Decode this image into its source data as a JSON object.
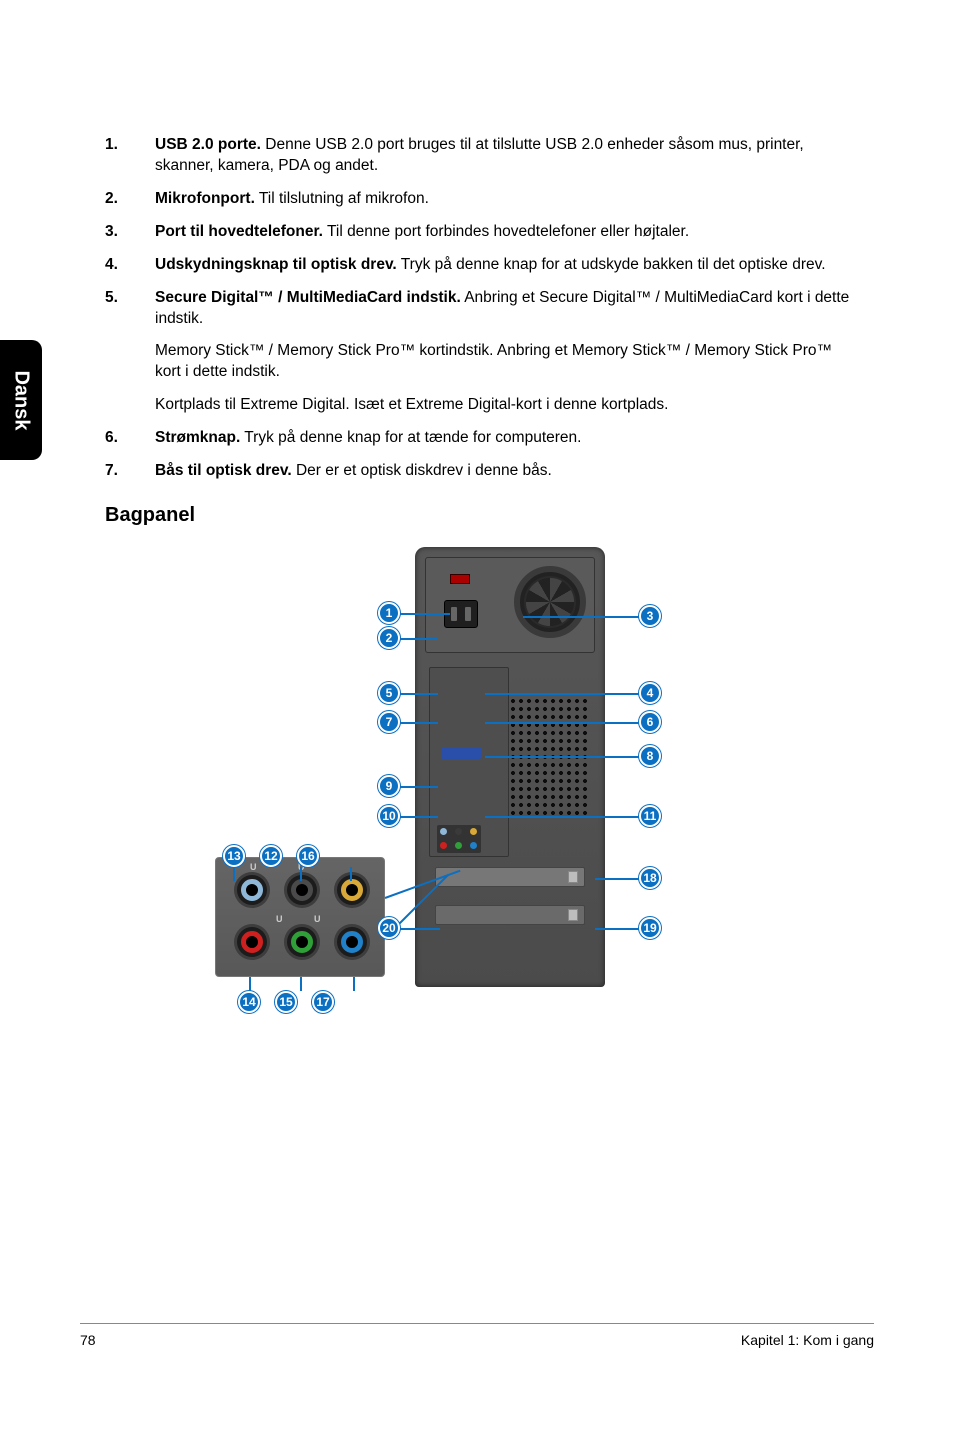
{
  "side_tab": "Dansk",
  "list": [
    {
      "num": "1.",
      "bold": "USB 2.0 porte.",
      "text": " Denne USB 2.0 port bruges til at tilslutte USB 2.0 enheder såsom mus, printer, skanner, kamera, PDA og andet."
    },
    {
      "num": "2.",
      "bold": "Mikrofonport.",
      "text": " Til tilslutning af mikrofon."
    },
    {
      "num": "3.",
      "bold": "Port til hovedtelefoner.",
      "text": " Til denne port forbindes hovedtelefoner eller højtaler."
    },
    {
      "num": "4.",
      "bold": "Udskydningsknap til optisk drev.",
      "text": " Tryk på denne knap for at udskyde bakken til det optiske drev."
    },
    {
      "num": "5.",
      "bold": "Secure Digital™ / MultiMediaCard indstik.",
      "text": " Anbring et Secure Digital™ / MultiMediaCard kort i dette indstik."
    }
  ],
  "sub_paras": [
    {
      "bold": "Memory Stick™ / Memory Stick Pro™ kortindstik.",
      "text": " Anbring et Memory Stick™ / Memory Stick Pro™ kort i dette indstik."
    },
    {
      "bold": "Kortplads til Extreme Digital.",
      "text": " Isæt et Extreme Digital-kort i denne kortplads."
    }
  ],
  "list2": [
    {
      "num": "6.",
      "bold": "Strømknap.",
      "text": " Tryk på denne knap for at tænde for computeren."
    },
    {
      "num": "7.",
      "bold": "Bås til optisk drev.",
      "text": " Der er et optisk diskdrev i denne bås."
    }
  ],
  "section_title": "Bagpanel",
  "callouts": {
    "c1": "1",
    "c2": "2",
    "c3": "3",
    "c4": "4",
    "c5": "5",
    "c6": "6",
    "c7": "7",
    "c8": "8",
    "c9": "9",
    "c10": "10",
    "c11": "11",
    "c12": "12",
    "c13": "13",
    "c14": "14",
    "c15": "15",
    "c16": "16",
    "c17": "17",
    "c18": "18",
    "c19": "19",
    "c20": "20"
  },
  "footer": {
    "page": "78",
    "chapter": "Kapitel 1: Kom i gang"
  }
}
